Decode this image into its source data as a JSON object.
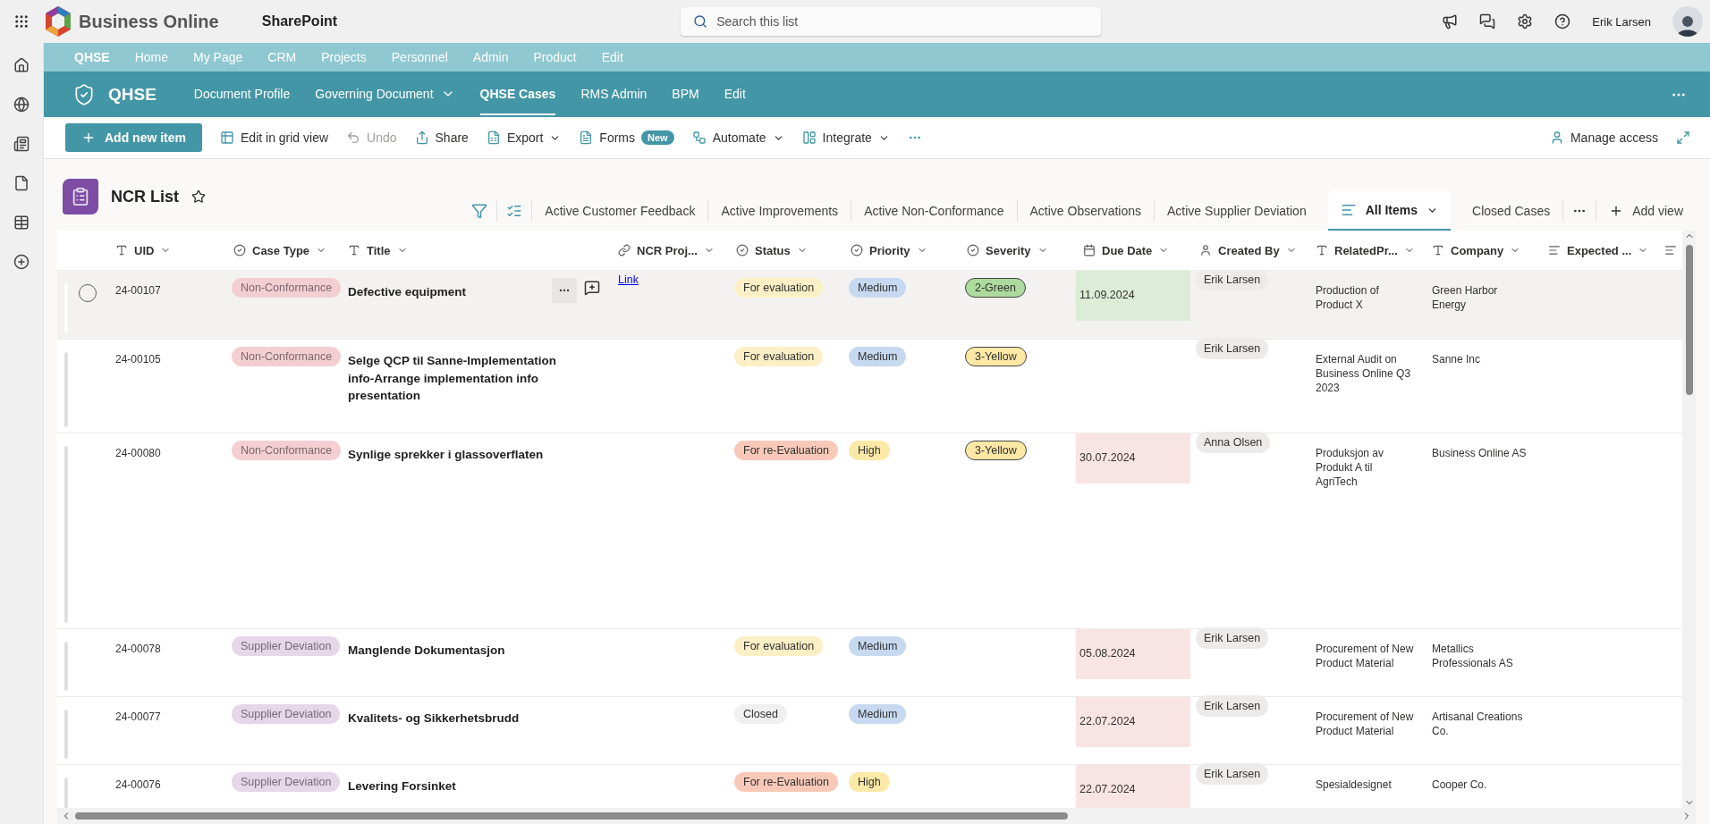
{
  "top_bar": {
    "brand": "Business Online",
    "product": "SharePoint",
    "search": {
      "placeholder": "Search this list"
    },
    "user": "Erik Larsen"
  },
  "hub_nav": {
    "title": "QHSE",
    "links": [
      "Home",
      "My Page",
      "CRM",
      "Projects",
      "Personnel",
      "Admin",
      "Product",
      "Edit"
    ]
  },
  "site_nav": {
    "title": "QHSE",
    "links": [
      {
        "label": "Document Profile",
        "selected": false,
        "dropdown": false
      },
      {
        "label": "Governing Document",
        "selected": false,
        "dropdown": true
      },
      {
        "label": "QHSE Cases",
        "selected": true,
        "dropdown": false
      },
      {
        "label": "RMS Admin",
        "selected": false,
        "dropdown": false
      },
      {
        "label": "BPM",
        "selected": false,
        "dropdown": false
      },
      {
        "label": "Edit",
        "selected": false,
        "dropdown": false
      }
    ]
  },
  "command_bar": {
    "items": [
      {
        "kind": "add",
        "label": "Add new item"
      },
      {
        "kind": "grid",
        "label": "Edit in grid view",
        "disabled": false,
        "dropdown": false
      },
      {
        "kind": "undo",
        "label": "Undo",
        "disabled": true,
        "dropdown": false
      },
      {
        "kind": "share",
        "label": "Share",
        "disabled": false,
        "dropdown": false
      },
      {
        "kind": "export",
        "label": "Export",
        "disabled": false,
        "dropdown": true
      },
      {
        "kind": "forms",
        "label": "Forms",
        "badge": "New",
        "disabled": false,
        "dropdown": false
      },
      {
        "kind": "automate",
        "label": "Automate",
        "disabled": false,
        "dropdown": true
      },
      {
        "kind": "integrate",
        "label": "Integrate",
        "disabled": false,
        "dropdown": true
      }
    ],
    "manage_access": "Manage access"
  },
  "list": {
    "title": "NCR List",
    "favorite": false,
    "views": [
      {
        "label": "Active Customer Feedback",
        "selected": false
      },
      {
        "label": "Active Improvements",
        "selected": false
      },
      {
        "label": "Active Non-Conformance",
        "selected": false
      },
      {
        "label": "Active Observations",
        "selected": false
      },
      {
        "label": "Active Supplier Deviation",
        "selected": false
      },
      {
        "label": "All Items",
        "selected": true
      },
      {
        "label": "Closed Cases",
        "selected": false
      }
    ],
    "add_view": "Add view"
  },
  "columns": [
    {
      "kind": "text",
      "label": "UID"
    },
    {
      "kind": "choice",
      "label": "Case Type"
    },
    {
      "kind": "text",
      "label": "Title"
    },
    {
      "kind": "link",
      "label": "NCR Proj..."
    },
    {
      "kind": "choice",
      "label": "Status"
    },
    {
      "kind": "choice",
      "label": "Priority"
    },
    {
      "kind": "choice",
      "label": "Severity"
    },
    {
      "kind": "date",
      "label": "Due Date"
    },
    {
      "kind": "person",
      "label": "Created By"
    },
    {
      "kind": "text",
      "label": "RelatedPr..."
    },
    {
      "kind": "text",
      "label": "Company"
    },
    {
      "kind": "multiline",
      "label": "Expected ..."
    },
    {
      "kind": "multiline"
    }
  ],
  "rows": [
    {
      "highlighted": true,
      "uid": "24-00107",
      "case_type": {
        "text": "Non-Conformance",
        "color": "#f4cfd1"
      },
      "title": "Defective equipment",
      "ncr_project": "Link",
      "status": {
        "text": "For evaluation",
        "color": "#fbefc6"
      },
      "priority": {
        "text": "Medium",
        "color": "#c7d9f0"
      },
      "severity": {
        "text": "2-Green",
        "color": "#acdb9d"
      },
      "due_date": {
        "text": "11.09.2024",
        "color": "#dcecd6"
      },
      "created_by": "Erik Larsen",
      "related_project": "Production of Product X",
      "company": "Green Harbor Energy"
    },
    {
      "highlighted": false,
      "uid": "24-00105",
      "case_type": {
        "text": "Non-Conformance",
        "color": "#f4cfd1"
      },
      "title": "Selge QCP til Sanne-Implementation info-Arrange implementation info presentation",
      "status": {
        "text": "For evaluation",
        "color": "#fbefc6"
      },
      "priority": {
        "text": "Medium",
        "color": "#c7d9f0"
      },
      "severity": {
        "text": "3-Yellow",
        "color": "#fde8a6"
      },
      "created_by": "Erik Larsen",
      "related_project": "External Audit on Business Online Q3 2023",
      "company": "Sanne Inc"
    },
    {
      "highlighted": false,
      "uid": "24-00080",
      "case_type": {
        "text": "Non-Conformance",
        "color": "#f4cfd1"
      },
      "title": "Synlige sprekker i glassoverflaten",
      "status": {
        "text": "For re-Evaluation",
        "color": "#f8c9b9"
      },
      "priority": {
        "text": "High",
        "color": "#fbe9a8"
      },
      "severity": {
        "text": "3-Yellow",
        "color": "#fde8a6"
      },
      "due_date": {
        "text": "30.07.2024",
        "color": "#f9e4e4"
      },
      "created_by": "Anna Olsen",
      "related_project": "Produksjon av Produkt A til AgriTech",
      "company": "Business Online AS"
    },
    {
      "highlighted": false,
      "uid": "24-00078",
      "case_type": {
        "text": "Supplier Deviation",
        "color": "#e5d6e8"
      },
      "title": "Manglende Dokumentasjon",
      "status": {
        "text": "For evaluation",
        "color": "#fbefc6"
      },
      "priority": {
        "text": "Medium",
        "color": "#c7d9f0"
      },
      "due_date": {
        "text": "05.08.2024",
        "color": "#f9e4e4"
      },
      "created_by": "Erik Larsen",
      "related_project": "Procurement of New Product Material",
      "company": "Metallics Professionals AS"
    },
    {
      "highlighted": false,
      "uid": "24-00077",
      "case_type": {
        "text": "Supplier Deviation",
        "color": "#e5d6e8"
      },
      "title": "Kvalitets- og Sikkerhetsbrudd",
      "status": {
        "text": "Closed",
        "color": "#f0f0f0"
      },
      "priority": {
        "text": "Medium",
        "color": "#c7d9f0"
      },
      "due_date": {
        "text": "22.07.2024",
        "color": "#f9e4e4"
      },
      "created_by": "Erik Larsen",
      "related_project": "Procurement of New Product Material",
      "company": "Artisanal Creations Co."
    },
    {
      "highlighted": false,
      "uid": "24-00076",
      "case_type": {
        "text": "Supplier Deviation",
        "color": "#e5d6e8"
      },
      "title": "Levering Forsinket",
      "status": {
        "text": "For re-Evaluation",
        "color": "#f8c9b9"
      },
      "priority": {
        "text": "High",
        "color": "#fbe9a8"
      },
      "due_date": {
        "text": "22.07.2024",
        "color": "#f9e4e4"
      },
      "created_by": "Erik Larsen",
      "related_project": "Spesialdesignet",
      "company": "Cooper Co."
    }
  ]
}
